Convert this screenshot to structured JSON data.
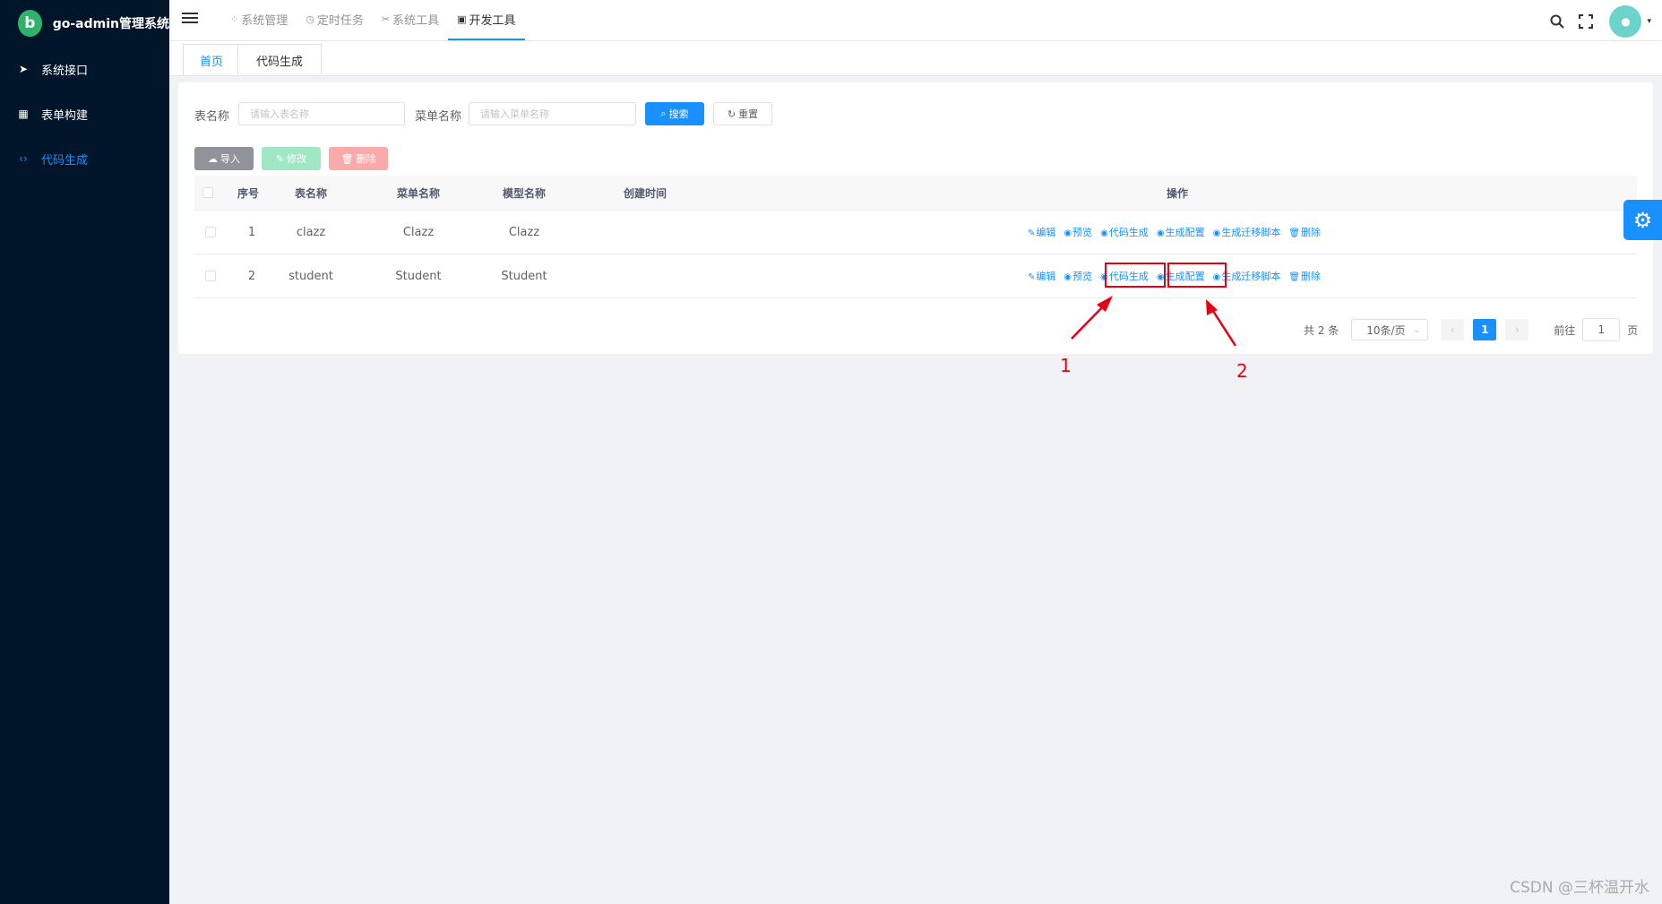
{
  "app": {
    "logo_letter": "b",
    "title": "go-admin管理系统"
  },
  "sidebar": {
    "items": [
      {
        "label": "系统接口",
        "icon": "send-icon",
        "active": false
      },
      {
        "label": "表单构建",
        "icon": "table-icon",
        "active": false
      },
      {
        "label": "代码生成",
        "icon": "code-icon",
        "active": true
      }
    ]
  },
  "topnav": {
    "items": [
      {
        "label": "系统管理",
        "icon": "grid-icon"
      },
      {
        "label": "定时任务",
        "icon": "clock-icon"
      },
      {
        "label": "系统工具",
        "icon": "tools-icon"
      },
      {
        "label": "开发工具",
        "icon": "devtools-icon",
        "active": true
      }
    ]
  },
  "tags": [
    {
      "label": "首页",
      "active": true
    },
    {
      "label": "代码生成",
      "active": false
    }
  ],
  "filters": {
    "table_name_label": "表名称",
    "table_name_placeholder": "请输入表名称",
    "menu_name_label": "菜单名称",
    "menu_name_placeholder": "请输入菜单名称",
    "search_label": "搜索",
    "reset_label": "重置"
  },
  "actions": {
    "import_label": "导入",
    "edit_label": "修改",
    "delete_label": "删除"
  },
  "table": {
    "columns": [
      "序号",
      "表名称",
      "菜单名称",
      "模型名称",
      "创建时间",
      "操作"
    ],
    "rows": [
      {
        "index": "1",
        "table_name": "clazz",
        "menu_name": "Clazz",
        "model_name": "Clazz",
        "created": ""
      },
      {
        "index": "2",
        "table_name": "student",
        "menu_name": "Student",
        "model_name": "Student",
        "created": ""
      }
    ],
    "row_ops": [
      "编辑",
      "预览",
      "代码生成",
      "生成配置",
      "生成迁移脚本",
      "删除"
    ]
  },
  "pagination": {
    "total": "共 2 条",
    "page_size": "10条/页",
    "current_page": "1",
    "goto_label": "前往",
    "goto_value": "1",
    "page_unit": "页"
  },
  "annotations": {
    "arrow1_label": "1",
    "arrow2_label": "2",
    "color": "#e60012"
  },
  "colors": {
    "primary": "#1890ff",
    "sidebar_bg": "#001529",
    "page_bg": "#f0f2f5"
  },
  "watermark": "CSDN @三杯温开水"
}
